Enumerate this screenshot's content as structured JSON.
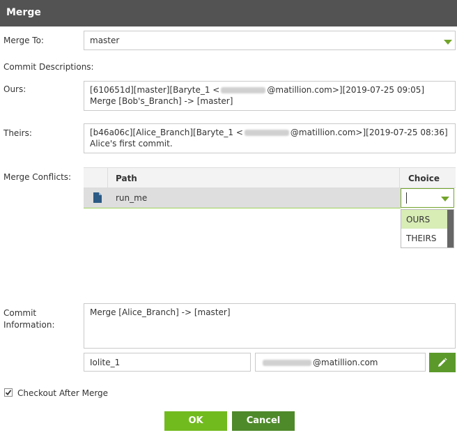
{
  "window": {
    "title": "Merge"
  },
  "merge_to": {
    "label": "Merge To:",
    "value": "master"
  },
  "commit_descriptions": {
    "label": "Commit Descriptions:"
  },
  "ours": {
    "label": "Ours:",
    "line1_prefix": "[610651d][master][Baryte_1 <",
    "line1_suffix": "@matillion.com>][2019-07-25 09:05]",
    "line2": "Merge [Bob's_Branch] -> [master]"
  },
  "theirs": {
    "label": "Theirs:",
    "line1_prefix": "[b46a06c][Alice_Branch][Baryte_1 <",
    "line1_suffix": "@matillion.com>][2019-07-25 08:36]",
    "line2": "Alice's first commit."
  },
  "merge_conflicts": {
    "label": "Merge Conflicts:",
    "columns": {
      "path": "Path",
      "choice": "Choice"
    },
    "rows": [
      {
        "path": "run_me",
        "choice": ""
      }
    ],
    "choice_options": [
      "OURS",
      "THEIRS"
    ],
    "highlighted_option": "OURS"
  },
  "commit_information": {
    "label_line1": "Commit",
    "label_line2": "Information:",
    "message": "Merge [Alice_Branch] -> [master]",
    "username": "Iolite_1",
    "email_suffix": "@matillion.com"
  },
  "checkout_after_merge": {
    "label": "Checkout After Merge",
    "checked": true
  },
  "buttons": {
    "ok": "OK",
    "cancel": "Cancel"
  },
  "colors": {
    "title_bar": "#535353",
    "accent_green": "#72bb1f",
    "dark_green": "#4f8a2a",
    "highlight": "#d8ecb6"
  }
}
